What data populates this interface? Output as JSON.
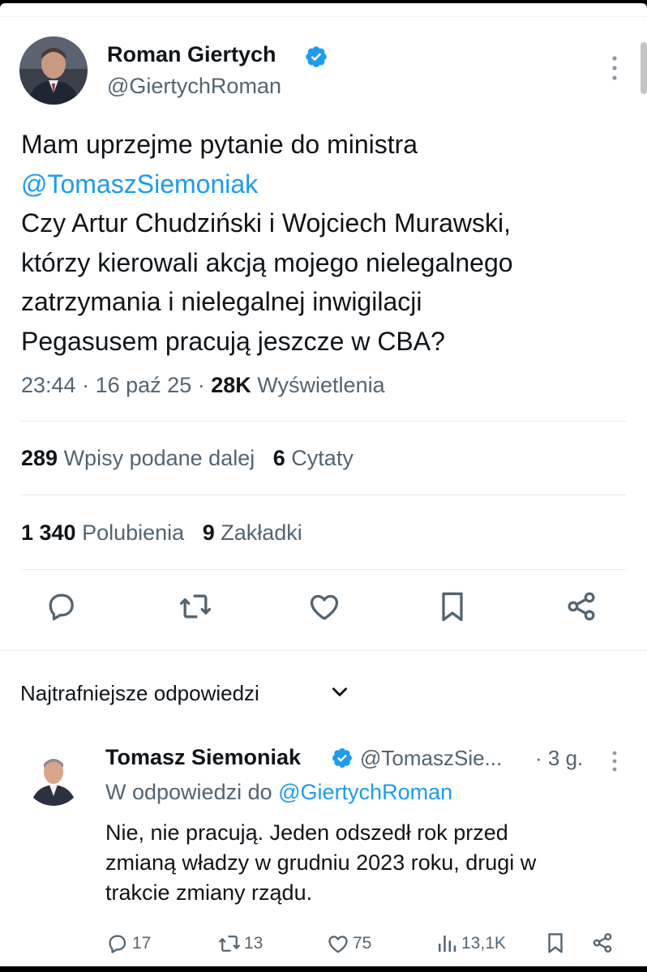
{
  "tweet": {
    "author_name": "Roman Giertych",
    "author_handle": "@GiertychRoman",
    "lines": [
      {
        "text": "Mam uprzejme pytanie do ministra",
        "mention": false
      },
      {
        "text": "@TomaszSiemoniak",
        "mention": true
      },
      {
        "text": "Czy Artur Chudziński i Wojciech Murawski,",
        "mention": false
      },
      {
        "text": "którzy kierowali akcją mojego nielegalnego",
        "mention": false
      },
      {
        "text": "zatrzymania i nielegalnej inwigilacji",
        "mention": false
      },
      {
        "text": "Pegasusem pracują jeszcze w CBA?",
        "mention": false
      }
    ],
    "time": "23:44",
    "separator": "·",
    "date": "16 paź 25",
    "views_count": "28K",
    "views_label": "Wyświetlenia"
  },
  "stats": {
    "reposts_count": "289",
    "reposts_label": "Wpisy podane dalej",
    "quotes_count": "6",
    "quotes_label": "Cytaty",
    "likes_count": "1 340",
    "likes_label": "Polubienia",
    "bookmarks_count": "9",
    "bookmarks_label": "Zakładki"
  },
  "sort": {
    "label": "Najtrafniejsze odpowiedzi"
  },
  "reply": {
    "author_name": "Tomasz Siemoniak",
    "author_handle": "@TomaszSie...",
    "time": "· 3 g.",
    "reply_to_prefix": "W odpowiedzi do",
    "reply_to_handle": "@GiertychRoman",
    "lines": [
      "Nie, nie pracują. Jeden odszedł rok przed",
      "zmianą władzy w grudniu 2023 roku, drugi w",
      "trakcie zmiany rządu."
    ],
    "replies_count": "17",
    "reposts_count": "13",
    "likes_count": "75",
    "views_count": "13,1K"
  },
  "icons": {
    "verified": "verified-badge-icon",
    "reply": "reply-icon",
    "repost": "repost-icon",
    "like": "heart-icon",
    "bookmark": "bookmark-icon",
    "share": "share-icon",
    "views": "views-bar-icon",
    "more": "more-vertical-icon",
    "chevron": "chevron-down-icon"
  },
  "colors": {
    "accent": "#1d9bf0",
    "text": "#0f1419",
    "secondary": "#536471"
  }
}
